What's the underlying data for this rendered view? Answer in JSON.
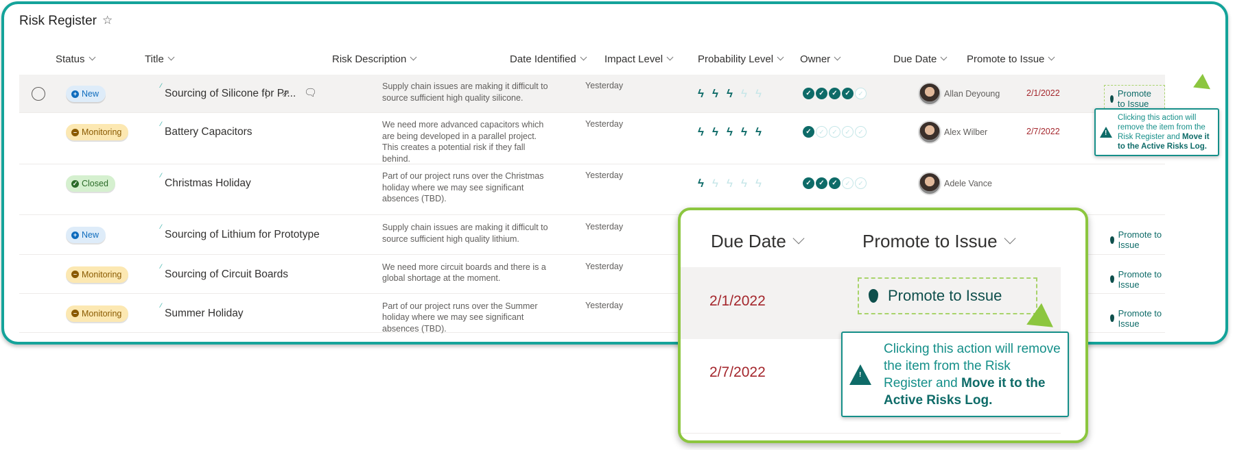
{
  "page": {
    "title": "Risk Register",
    "star_icon": "star-outline"
  },
  "columns": [
    "Status",
    "Title",
    "Risk Description",
    "Date Identified",
    "Impact Level",
    "Probability Level",
    "Owner",
    "Due Date",
    "Promote to Issue"
  ],
  "rows": [
    {
      "status": "New",
      "title": "Sourcing of Silicone for Pr...",
      "description": "Supply chain issues are making it difficult to source sufficient high quality silicone.",
      "date": "Yesterday",
      "impact": 3,
      "probability": 4,
      "owner": "Allan Deyoung",
      "due": "2/1/2022",
      "promote": "Promote to Issue"
    },
    {
      "status": "Monitoring",
      "title": "Battery Capacitors",
      "description": "We need more advanced capacitors which are being developed in a parallel project. This creates a potential risk if they fall behind.",
      "date": "Yesterday",
      "impact": 5,
      "probability": 1,
      "owner": "Alex Wilber",
      "due": "2/7/2022"
    },
    {
      "status": "Closed",
      "title": "Christmas Holiday",
      "description": "Part of our project runs over the Christmas holiday where we may see significant absences (TBD).",
      "date": "Yesterday",
      "impact": 1,
      "probability": 3,
      "owner": "Adele Vance"
    },
    {
      "status": "New",
      "title": "Sourcing of Lithium for Prototype",
      "description": "Supply chain issues are making it difficult to source sufficient high quality lithium.",
      "date": "Yesterday",
      "promote": "Promote to Issue"
    },
    {
      "status": "Monitoring",
      "title": "Sourcing of Circuit Boards",
      "description": "We need more circuit boards and there is a global shortage at the moment.",
      "date": "Yesterday",
      "promote": "Promote to Issue"
    },
    {
      "status": "Monitoring",
      "title": "Summer Holiday",
      "description": "Part of our project runs over the Summer holiday where we may see significant absences (TBD).",
      "date": "Yesterday",
      "promote": "Promote to Issue"
    }
  ],
  "tooltip": {
    "text1": "Clicking this action will remove the item from the Risk Register and ",
    "bold": "Move it to the Active Risks Log."
  },
  "inset": {
    "col1": "Due Date",
    "col2": "Promote to Issue",
    "due1": "2/1/2022",
    "due2": "2/7/2022",
    "button": "Promote to Issue"
  },
  "colors": {
    "accent": "#14a39a",
    "highlight": "#8cc63f",
    "due": "#a4262c",
    "teal": "#0e6b68"
  }
}
